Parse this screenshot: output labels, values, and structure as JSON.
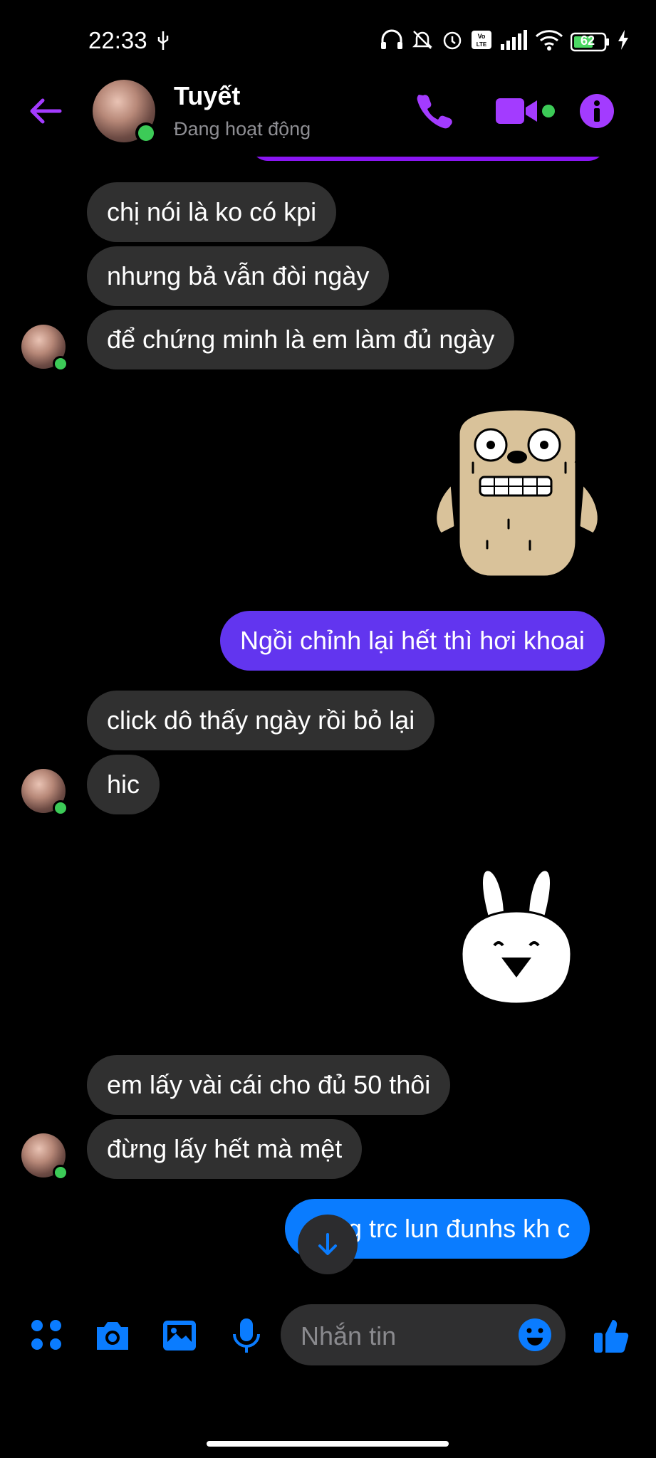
{
  "status_bar": {
    "time": "22:33",
    "battery": "62"
  },
  "header": {
    "contact_name": "Tuyết",
    "contact_status": "Đang hoạt động",
    "accent_color": "#8a16f3"
  },
  "messages": [
    {
      "from": "them",
      "text": "chị nói là ko có kpi"
    },
    {
      "from": "them",
      "text": "nhưng bả vẫn đòi ngày"
    },
    {
      "from": "them",
      "text": "để chứng minh là em làm đủ ngày"
    },
    {
      "from": "me",
      "type": "sticker",
      "name": "sweating-dog-sticker"
    },
    {
      "from": "me",
      "text": "Ngồi chỉnh lại hết thì hơi khoai"
    },
    {
      "from": "them",
      "text": "click dô thấy ngày rồi bỏ lại"
    },
    {
      "from": "them",
      "text": "hic"
    },
    {
      "from": "me",
      "type": "sticker",
      "name": "happy-rabbit-sticker"
    },
    {
      "from": "them",
      "text": "em lấy vài cái cho đủ 50 thôi"
    },
    {
      "from": "them",
      "text": "đừng lấy hết mà mệt"
    },
    {
      "from": "me",
      "text": "ng trc lun đunhs kh c"
    }
  ],
  "composer": {
    "placeholder": "Nhắn tin"
  },
  "colors": {
    "my_bubble": "#6235ef",
    "my_bubble_latest": "#0a7cff",
    "their_bubble": "#303030",
    "online": "#3ccb57"
  }
}
